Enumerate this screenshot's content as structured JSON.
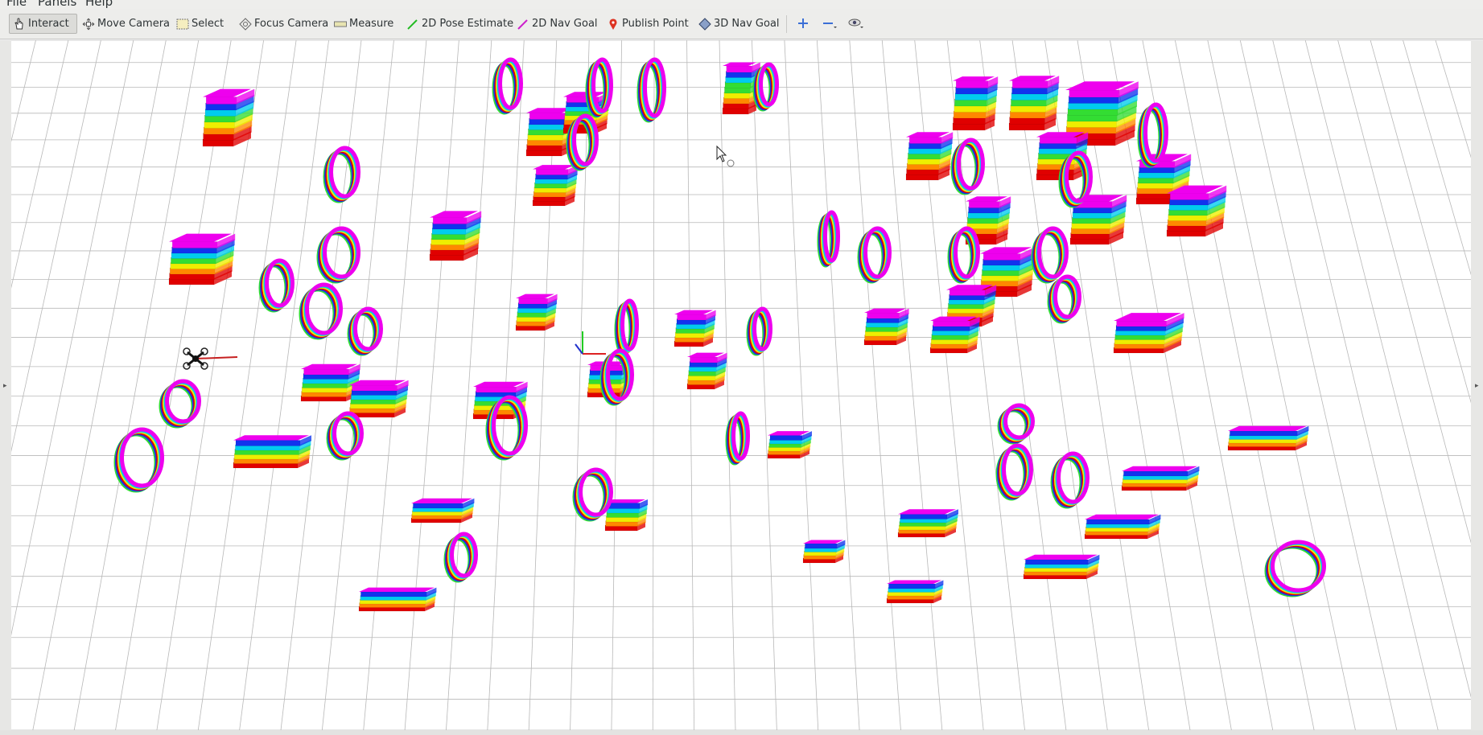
{
  "menubar": {
    "items": [
      "File",
      "Panels",
      "Help"
    ]
  },
  "toolbar": {
    "tools": [
      {
        "id": "interact",
        "label": "Interact",
        "icon": "hand-pointer-icon",
        "active": true
      },
      {
        "id": "move-camera",
        "label": "Move Camera",
        "icon": "move-arrows-icon",
        "active": false
      },
      {
        "id": "select",
        "label": "Select",
        "icon": "select-box-icon",
        "active": false
      },
      {
        "id": "focus-camera",
        "label": "Focus Camera",
        "icon": "focus-crosshair-icon",
        "active": false
      },
      {
        "id": "measure",
        "label": "Measure",
        "icon": "ruler-icon",
        "active": false
      },
      {
        "id": "2d-pose-estimate",
        "label": "2D Pose Estimate",
        "icon": "green-arrow-icon",
        "active": false
      },
      {
        "id": "2d-nav-goal",
        "label": "2D Nav Goal",
        "icon": "magenta-arrow-icon",
        "active": false
      },
      {
        "id": "publish-point",
        "label": "Publish Point",
        "icon": "map-pin-icon",
        "active": false
      },
      {
        "id": "3d-nav-goal",
        "label": "3D Nav Goal",
        "icon": "diamond-icon",
        "active": false
      }
    ],
    "view_buttons": [
      "add-tool-icon",
      "remove-tool-icon",
      "camera-view-icon"
    ]
  },
  "colors": {
    "grid_line": "#b8b8b8",
    "background": "#ffffff",
    "height_ramp": [
      "#e00000",
      "#ff8800",
      "#eeee00",
      "#33dd33",
      "#00ccee",
      "#1133ee",
      "#ee00ee"
    ]
  },
  "scene": {
    "type": "rviz-3d-viewport",
    "content": "voxel occupancy map of obstacles on a ground grid, colored by height"
  }
}
